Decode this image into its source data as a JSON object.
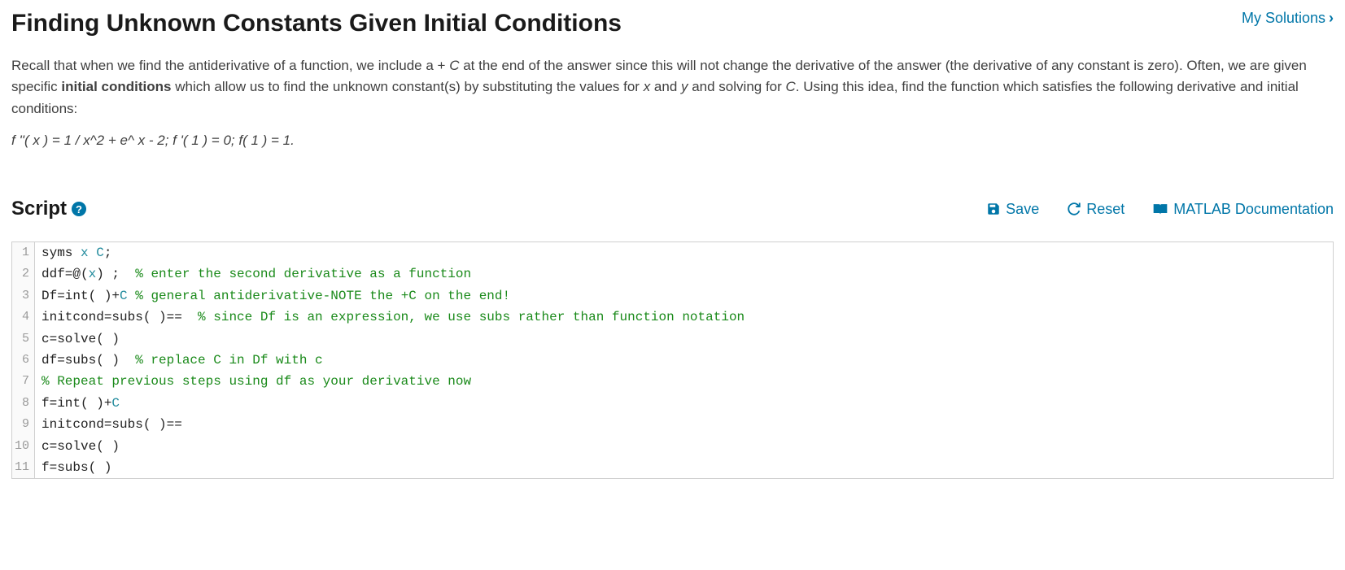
{
  "header": {
    "title": "Finding Unknown Constants Given Initial Conditions",
    "my_solutions": "My Solutions"
  },
  "problem": {
    "p1_a": "Recall that when we find the antiderivative of a function, we include a + ",
    "p1_C": "C",
    "p1_b": " at the end of the answer since this will not change the derivative of the answer (the derivative of any constant is zero). Often, we are given specific ",
    "p1_bold": "initial conditions",
    "p1_c": " which allow us to find the unknown constant(s) by substituting the values for ",
    "p1_x": "x",
    "p1_d": " and ",
    "p1_y": "y",
    "p1_e": " and solving for ",
    "p1_C2": "C",
    "p1_f": ". Using this idea, find the function which satisfies the following derivative and initial conditions:",
    "equation": "f ''( x ) = 1 / x^2 + e^ x - 2; f '( 1 ) = 0; f( 1 ) = 1."
  },
  "script": {
    "title": "Script",
    "help": "?",
    "save": "Save",
    "reset": "Reset",
    "docs": "MATLAB Documentation"
  },
  "code": {
    "l1": {
      "pre": "syms ",
      "sym1": "x",
      "mid": " ",
      "sym2": "C",
      "post": ";"
    },
    "l2": {
      "pre": "ddf=@(",
      "sym1": "x",
      "post": ") ;  ",
      "comment": "% enter the second derivative as a function"
    },
    "l3": {
      "pre": "Df=int( )+",
      "sym1": "C",
      "post": " ",
      "comment": "% general antiderivative-NOTE the +C on the end!"
    },
    "l4": {
      "pre": "initcond=subs( )==  ",
      "comment": "% since Df is an expression, we use subs rather than function notation"
    },
    "l5": {
      "pre": "c=solve( )"
    },
    "l6": {
      "pre": "df=subs( )  ",
      "comment": "% replace C in Df with c"
    },
    "l7": {
      "comment": "% Repeat previous steps using df as your derivative now"
    },
    "l8": {
      "pre": "f=int( )+",
      "sym1": "C"
    },
    "l9": {
      "pre": "initcond=subs( )=="
    },
    "l10": {
      "pre": "c=solve( )"
    },
    "l11": {
      "pre": "f=subs( )"
    }
  },
  "line_numbers": [
    "1",
    "2",
    "3",
    "4",
    "5",
    "6",
    "7",
    "8",
    "9",
    "10",
    "11"
  ]
}
